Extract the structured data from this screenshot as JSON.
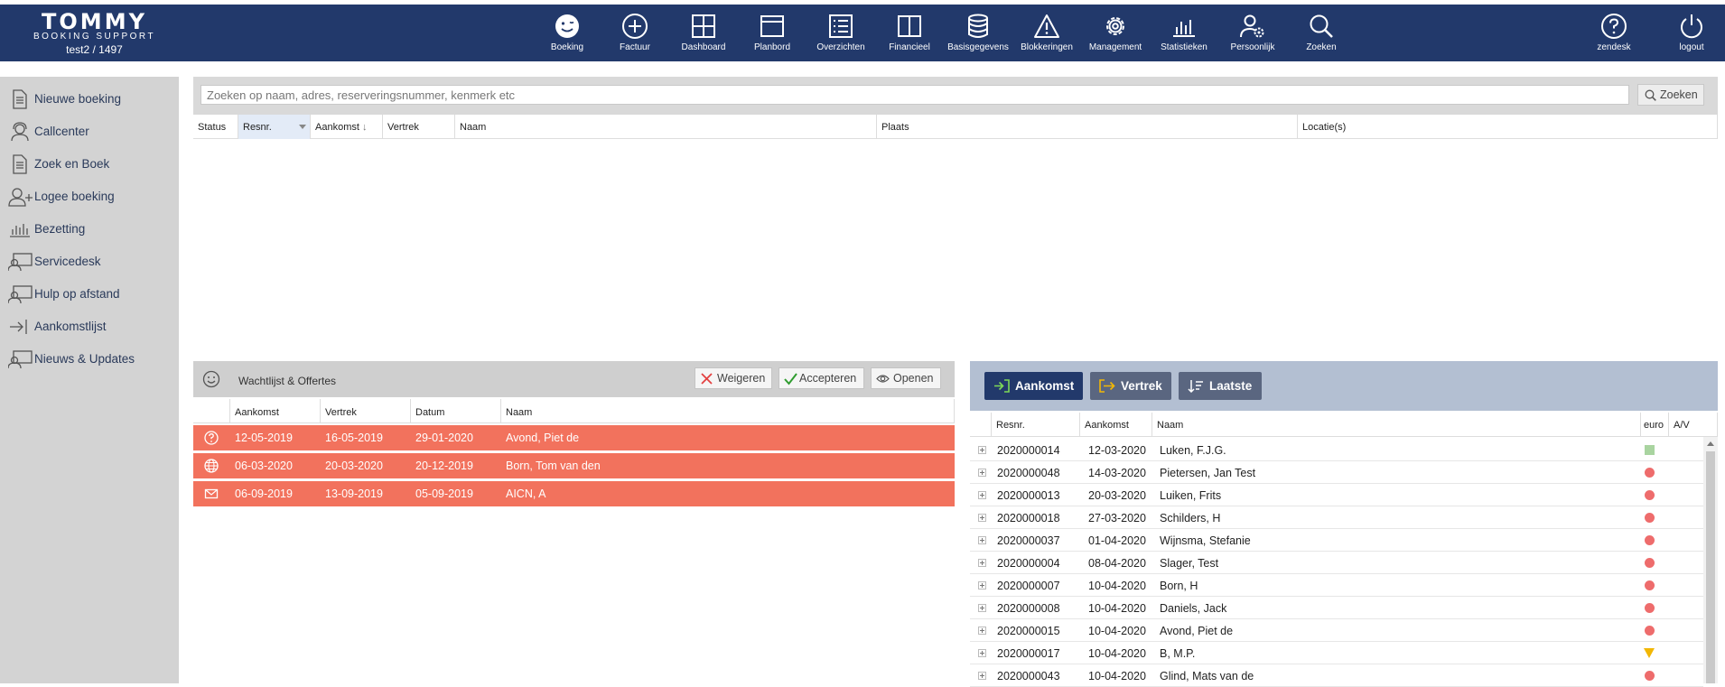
{
  "header": {
    "brand": "TOMMY",
    "subtitle": "BOOKING SUPPORT",
    "user": "test2 / 1497",
    "nav": [
      {
        "label": "Boeking",
        "icon": "smiley-icon"
      },
      {
        "label": "Factuur",
        "icon": "plus-circle-icon"
      },
      {
        "label": "Dashboard",
        "icon": "grid-icon"
      },
      {
        "label": "Planbord",
        "icon": "board-icon"
      },
      {
        "label": "Overzichten",
        "icon": "list-icon"
      },
      {
        "label": "Financieel",
        "icon": "book-icon"
      },
      {
        "label": "Basisgegevens",
        "icon": "database-icon"
      },
      {
        "label": "Blokkeringen",
        "icon": "warning-icon"
      },
      {
        "label": "Management",
        "icon": "gear-icon"
      },
      {
        "label": "Statistieken",
        "icon": "bar-chart-icon"
      },
      {
        "label": "Persoonlijk",
        "icon": "user-gear-icon"
      },
      {
        "label": "Zoeken",
        "icon": "search-icon"
      }
    ],
    "right": [
      {
        "label": "zendesk",
        "icon": "help-icon"
      },
      {
        "label": "logout",
        "icon": "power-icon"
      }
    ]
  },
  "sidebar": {
    "items": [
      {
        "label": "Nieuwe boeking",
        "icon": "document-icon"
      },
      {
        "label": "Callcenter",
        "icon": "headset-icon"
      },
      {
        "label": "Zoek en Boek",
        "icon": "document-search-icon"
      },
      {
        "label": "Logee boeking",
        "icon": "user-add-icon"
      },
      {
        "label": "Bezetting",
        "icon": "chart-icon"
      },
      {
        "label": "Servicedesk",
        "icon": "support-icon"
      },
      {
        "label": "Hulp op afstand",
        "icon": "remote-icon"
      },
      {
        "label": "Aankomstlijst",
        "icon": "arrival-icon"
      },
      {
        "label": "Nieuws & Updates",
        "icon": "news-icon"
      }
    ]
  },
  "search": {
    "placeholder": "Zoeken op naam, adres, reserveringsnummer, kenmerk etc",
    "value": "",
    "button_label": "Zoeken",
    "columns": [
      "Status",
      "Resnr.",
      "Aankomst",
      "Vertrek",
      "Naam",
      "Plaats",
      "Locatie(s)"
    ]
  },
  "waitlist": {
    "title": "Wachtlijst & Offertes",
    "buttons": {
      "reject": "Weigeren",
      "accept": "Accepteren",
      "open": "Openen"
    },
    "columns": [
      "Aankomst",
      "Vertrek",
      "Datum",
      "Naam"
    ],
    "rows": [
      {
        "icon": "question-icon",
        "aankomst": "12-05-2019",
        "vertrek": "16-05-2019",
        "datum": "29-01-2020",
        "naam": "Avond, Piet de"
      },
      {
        "icon": "globe-icon",
        "aankomst": "06-03-2020",
        "vertrek": "20-03-2020",
        "datum": "20-12-2019",
        "naam": "Born, Tom van den"
      },
      {
        "icon": "mail-icon",
        "aankomst": "06-09-2019",
        "vertrek": "13-09-2019",
        "datum": "05-09-2019",
        "naam": "AICN, A"
      }
    ]
  },
  "arrivals": {
    "tabs": {
      "arrival": "Aankomst",
      "departure": "Vertrek",
      "latest": "Laatste"
    },
    "columns": [
      "Resnr.",
      "Aankomst",
      "Naam",
      "euro",
      "A/V"
    ],
    "colors": {
      "green": "#a9d4a0",
      "red": "#ee6c6c",
      "yellow": "#f2b705"
    },
    "rows": [
      {
        "resnr": "2020000014",
        "aankomst": "12-03-2020",
        "naam": "Luken, F.J.G.",
        "status": "green"
      },
      {
        "resnr": "2020000048",
        "aankomst": "14-03-2020",
        "naam": "Pietersen, Jan Test",
        "status": "red"
      },
      {
        "resnr": "2020000013",
        "aankomst": "20-03-2020",
        "naam": "Luiken, Frits",
        "status": "red"
      },
      {
        "resnr": "2020000018",
        "aankomst": "27-03-2020",
        "naam": "Schilders, H",
        "status": "red"
      },
      {
        "resnr": "2020000037",
        "aankomst": "01-04-2020",
        "naam": "Wijnsma, Stefanie",
        "status": "red"
      },
      {
        "resnr": "2020000004",
        "aankomst": "08-04-2020",
        "naam": "Slager, Test",
        "status": "red"
      },
      {
        "resnr": "2020000007",
        "aankomst": "10-04-2020",
        "naam": "Born, H",
        "status": "red"
      },
      {
        "resnr": "2020000008",
        "aankomst": "10-04-2020",
        "naam": "Daniels, Jack",
        "status": "red"
      },
      {
        "resnr": "2020000015",
        "aankomst": "10-04-2020",
        "naam": "Avond, Piet de",
        "status": "red"
      },
      {
        "resnr": "2020000017",
        "aankomst": "10-04-2020",
        "naam": "B, M.P.",
        "status": "yellow"
      },
      {
        "resnr": "2020000043",
        "aankomst": "10-04-2020",
        "naam": "Glind, Mats van de",
        "status": "red"
      }
    ]
  }
}
